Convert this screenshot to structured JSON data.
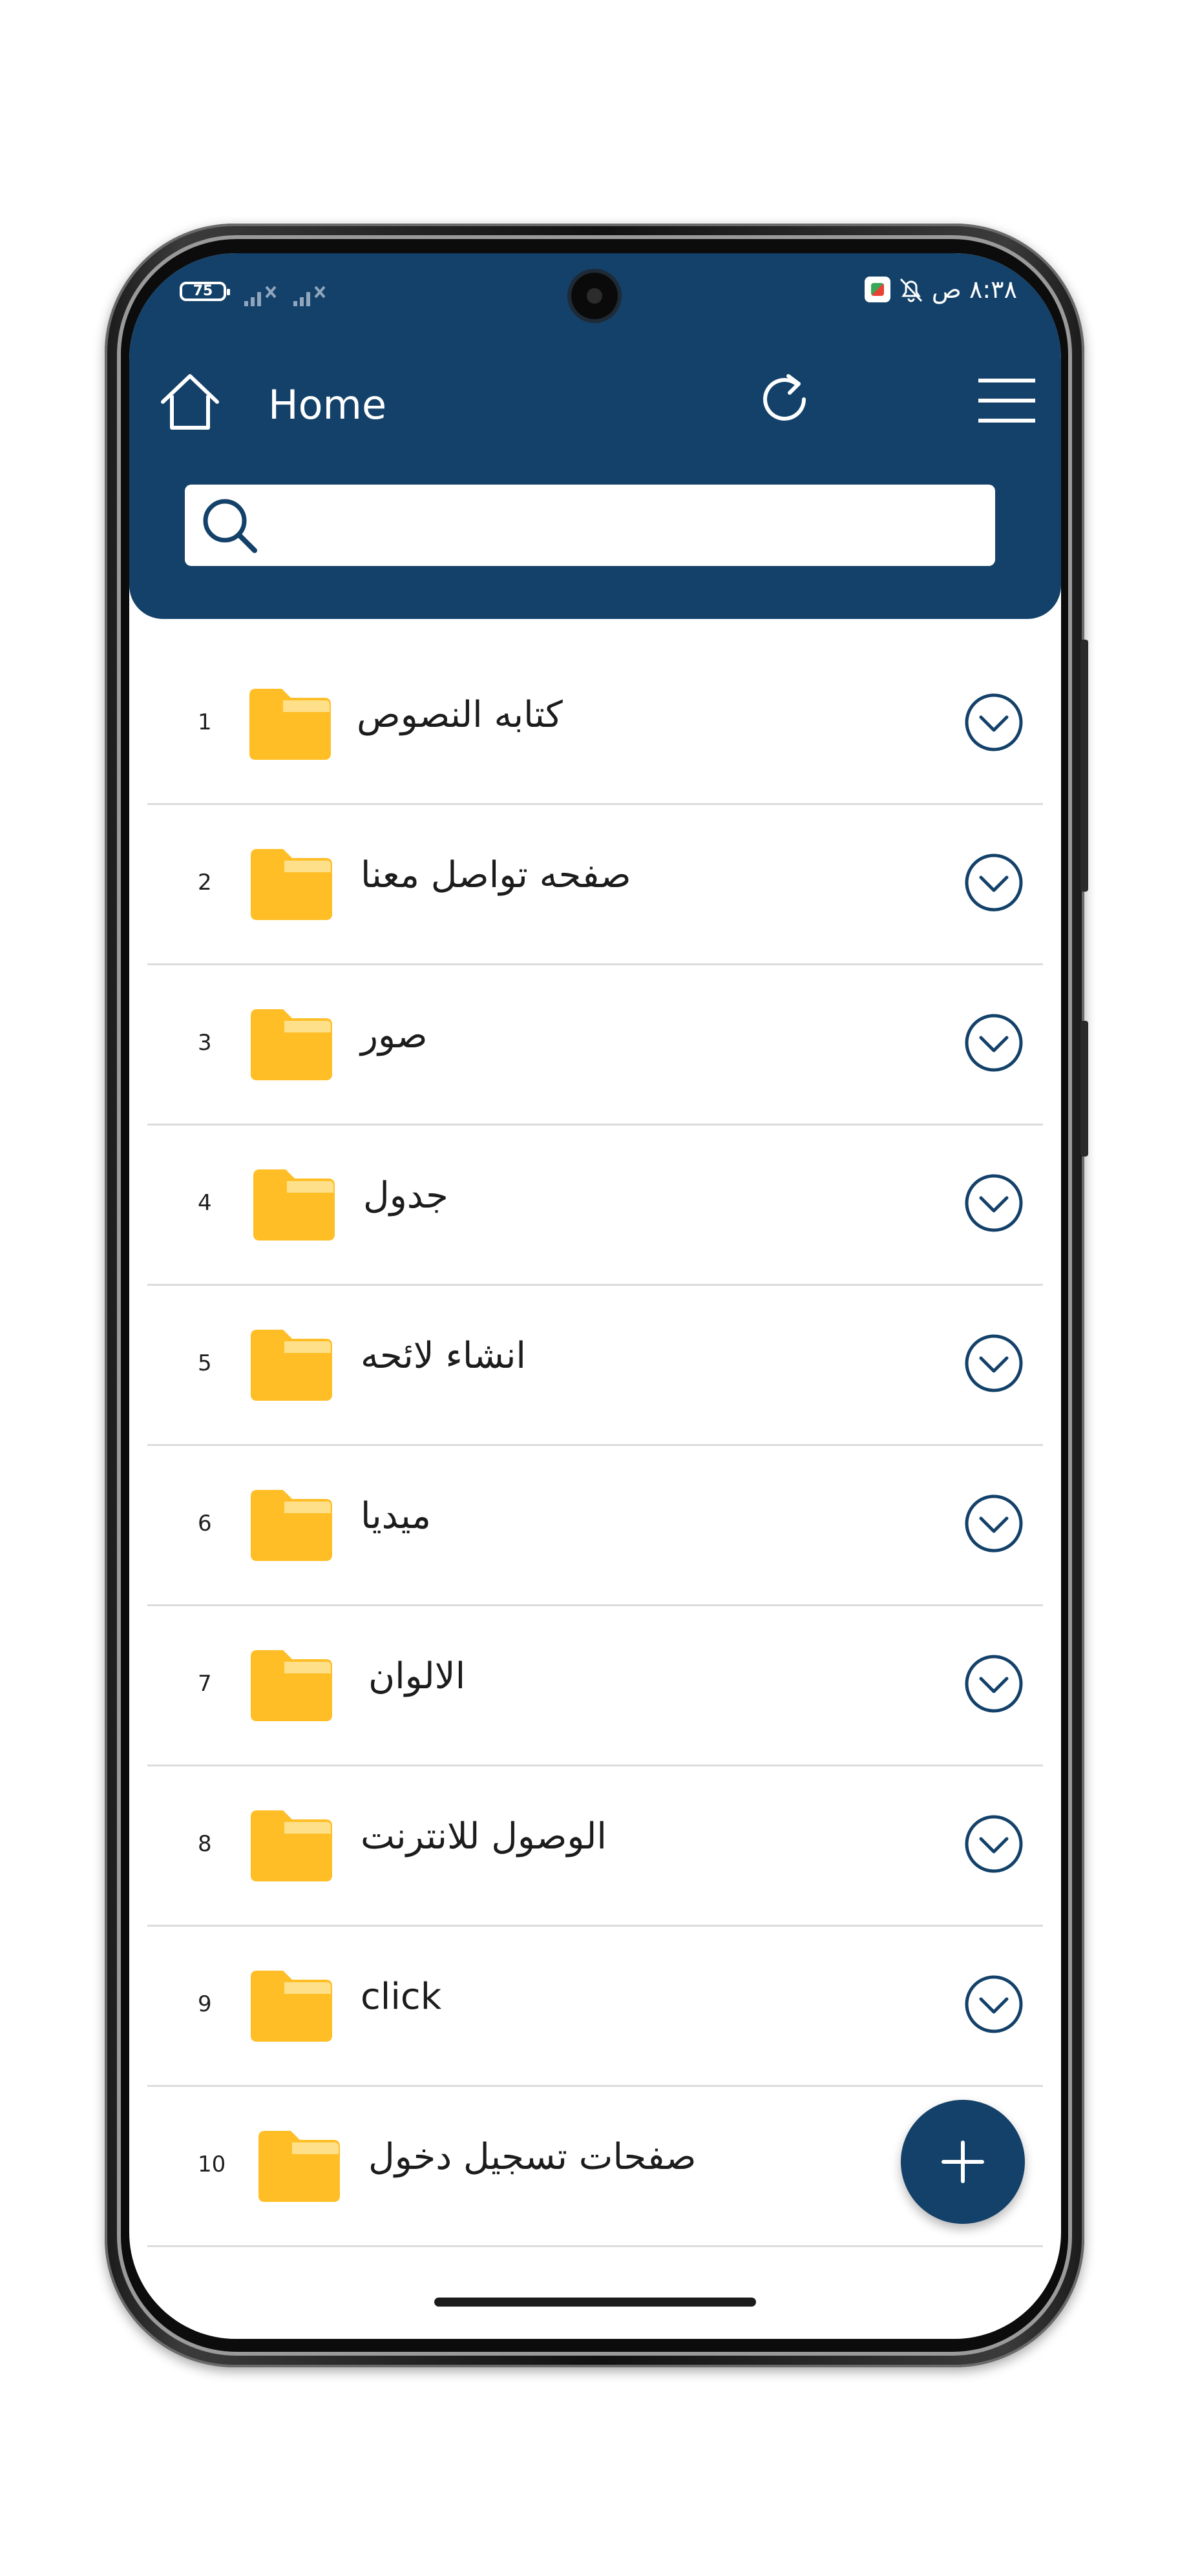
{
  "status_bar": {
    "battery": "75",
    "time": "٨:٣٨ ص"
  },
  "header": {
    "title": "Home",
    "search": {
      "placeholder": "",
      "value": ""
    }
  },
  "folders": [
    {
      "index": "1",
      "name": "كتابه النصوص"
    },
    {
      "index": "2",
      "name": "صفحه تواصل معنا"
    },
    {
      "index": "3",
      "name": "صور"
    },
    {
      "index": "4",
      "name": "جدول"
    },
    {
      "index": "5",
      "name": "انشاء لائحه"
    },
    {
      "index": "6",
      "name": "ميديا"
    },
    {
      "index": "7",
      "name": "الالوان"
    },
    {
      "index": "8",
      "name": "الوصول للانترنت"
    },
    {
      "index": "9",
      "name": "click"
    },
    {
      "index": "10",
      "name": "صفحات تسجيل دخول"
    }
  ],
  "colors": {
    "primary": "#134169",
    "folder": "#FFBE26",
    "folder_tab": "#FFE08A",
    "divider": "#DCDCDC"
  },
  "icons": {
    "home": "home-icon",
    "refresh": "refresh-icon",
    "menu": "hamburger-menu-icon",
    "search": "search-icon",
    "folder": "folder-icon",
    "expand": "chevron-down-icon",
    "add": "plus-icon"
  }
}
